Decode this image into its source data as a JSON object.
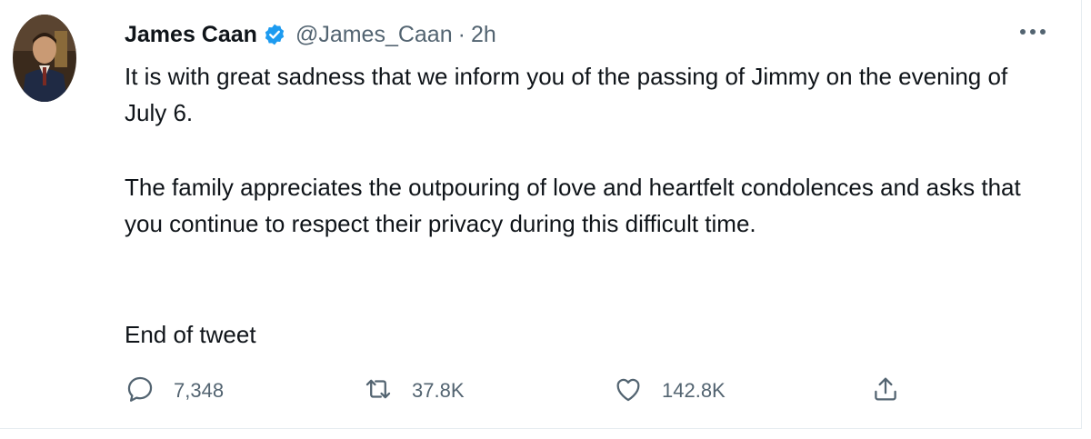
{
  "tweet": {
    "author": {
      "name": "James Caan",
      "handle": "@James_Caan",
      "separator": "·",
      "time": "2h",
      "verified": true,
      "avatar_icon": "profile-photo"
    },
    "text": {
      "line1": "It is with great sadness that we inform you of the passing of Jimmy on the evening of July 6.",
      "line2": "The family appreciates the outpouring of love and heartfelt condolences and asks that you continue to respect their privacy during this difficult time.",
      "line3": "End of tweet"
    },
    "actions": {
      "reply_count": "7,348",
      "retweet_count": "37.8K",
      "like_count": "142.8K"
    },
    "colors": {
      "verified": "#1d9bf0",
      "secondary_text": "#536471",
      "primary_text": "#0f1419"
    }
  }
}
